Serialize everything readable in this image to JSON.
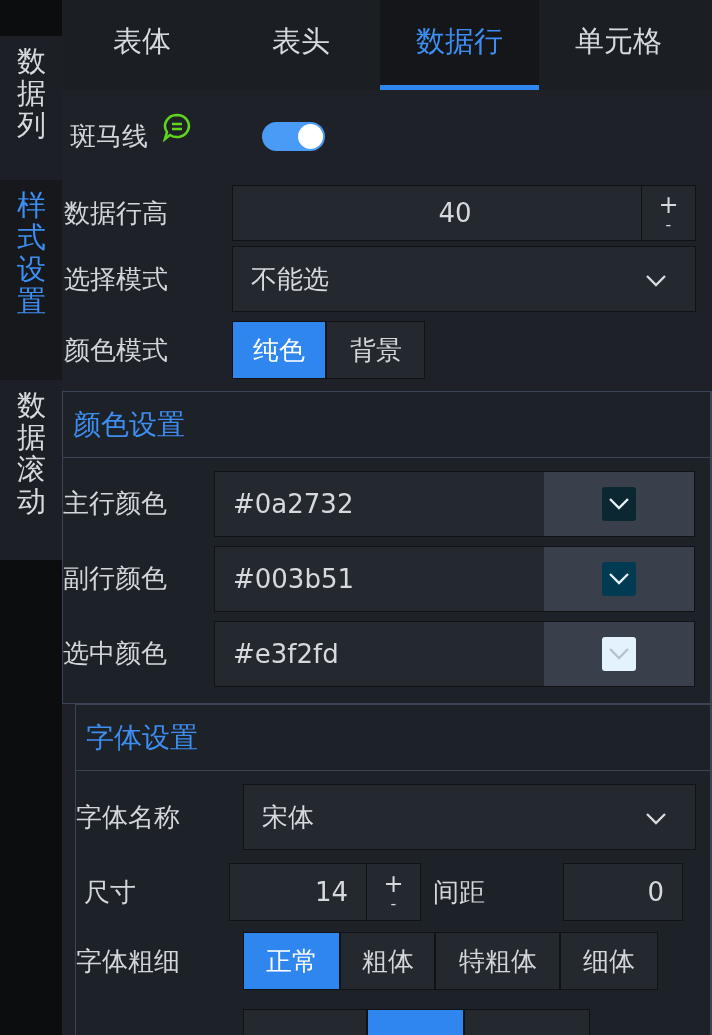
{
  "side_tabs": [
    {
      "label": "数据列",
      "selected": false
    },
    {
      "label": "样式设置",
      "selected": true
    },
    {
      "label": "数据滚动",
      "selected": false
    }
  ],
  "tabs": [
    {
      "label": "表体",
      "selected": false
    },
    {
      "label": "表头",
      "selected": false
    },
    {
      "label": "数据行",
      "selected": true
    },
    {
      "label": "单元格",
      "selected": false
    }
  ],
  "zebra": {
    "label": "斑马线",
    "on": true
  },
  "row_height": {
    "label": "数据行高",
    "value": "40",
    "plus": "+",
    "minus": "-"
  },
  "select_mode": {
    "label": "选择模式",
    "value": "不能选"
  },
  "color_mode": {
    "label": "颜色模式",
    "options": [
      {
        "label": "纯色",
        "selected": true
      },
      {
        "label": "背景",
        "selected": false
      }
    ]
  },
  "color_settings": {
    "title": "颜色设置",
    "rows": [
      {
        "label": "主行颜色",
        "value": "#0a2732",
        "color": "#0a2732"
      },
      {
        "label": "副行颜色",
        "value": "#003b51",
        "color": "#003b51"
      },
      {
        "label": "选中颜色",
        "value": "#e3f2fd",
        "color": "#e3f2fd"
      }
    ]
  },
  "font_settings": {
    "title": "字体设置",
    "font_name": {
      "label": "字体名称",
      "value": "宋体"
    },
    "size": {
      "label": "尺寸",
      "value": "14",
      "plus": "+",
      "minus": "-"
    },
    "spacing": {
      "label": "间距",
      "value": "0"
    },
    "weight": {
      "label": "字体粗细",
      "options": [
        {
          "label": "正常",
          "selected": true
        },
        {
          "label": "粗体",
          "selected": false
        },
        {
          "label": "特粗体",
          "selected": false
        },
        {
          "label": "细体",
          "selected": false
        }
      ]
    },
    "next_row_options": [
      {
        "selected": false
      },
      {
        "selected": true
      },
      {
        "selected": false
      }
    ]
  }
}
